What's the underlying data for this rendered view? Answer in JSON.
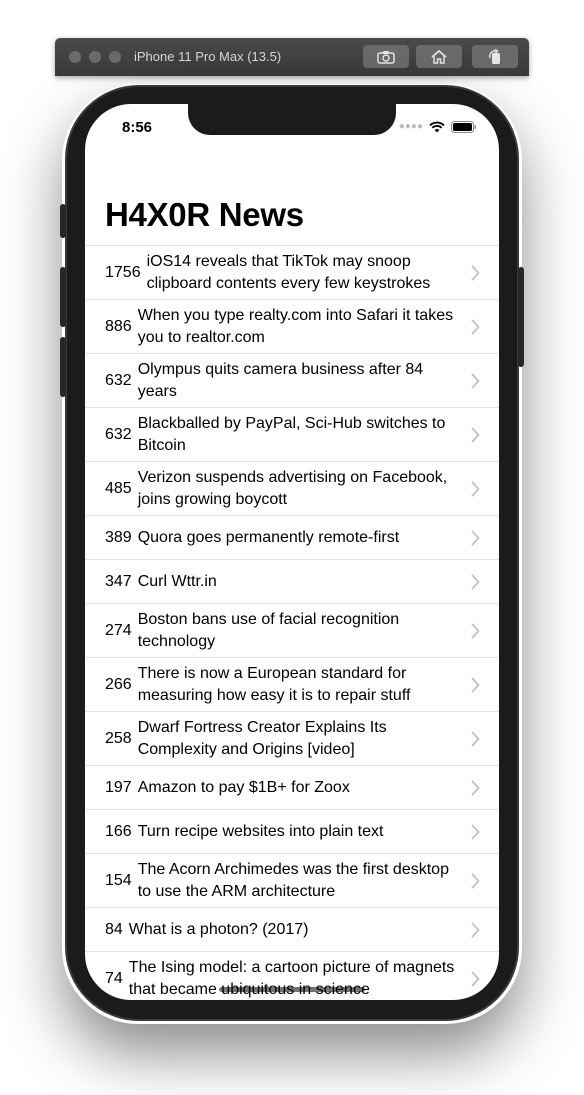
{
  "simulator": {
    "title": "iPhone 11 Pro Max (13.5)"
  },
  "status_bar": {
    "time": "8:56"
  },
  "app": {
    "title": "H4X0R News"
  },
  "stories": [
    {
      "points": "1756",
      "title": "iOS14 reveals that TikTok may snoop clipboard contents every few keystrokes"
    },
    {
      "points": "886",
      "title": "When you type realty.com into Safari it takes you to realtor.com"
    },
    {
      "points": "632",
      "title": "Olympus quits camera business after 84 years"
    },
    {
      "points": "632",
      "title": "Blackballed by PayPal, Sci-Hub switches to Bitcoin"
    },
    {
      "points": "485",
      "title": "Verizon suspends advertising on Facebook, joins growing boycott"
    },
    {
      "points": "389",
      "title": "Quora goes permanently remote-first"
    },
    {
      "points": "347",
      "title": "Curl Wttr.in"
    },
    {
      "points": "274",
      "title": "Boston bans use of facial recognition technology"
    },
    {
      "points": "266",
      "title": "There is now a European standard for measuring how easy it is to repair stuff"
    },
    {
      "points": "258",
      "title": "Dwarf Fortress Creator Explains Its Complexity and Origins [video]"
    },
    {
      "points": "197",
      "title": "Amazon to pay $1B+ for Zoox"
    },
    {
      "points": "166",
      "title": "Turn recipe websites into plain text"
    },
    {
      "points": "154",
      "title": "The Acorn Archimedes was the first desktop to use the ARM architecture"
    },
    {
      "points": "84",
      "title": "What is a photon? (2017)"
    },
    {
      "points": "74",
      "title": "The Ising model: a cartoon picture of magnets that became ubiquitous in science"
    }
  ],
  "colors": {
    "separator": "#e3e3e3",
    "chevron": "#c4c4c7",
    "device_frame": "#1b1b1b"
  }
}
